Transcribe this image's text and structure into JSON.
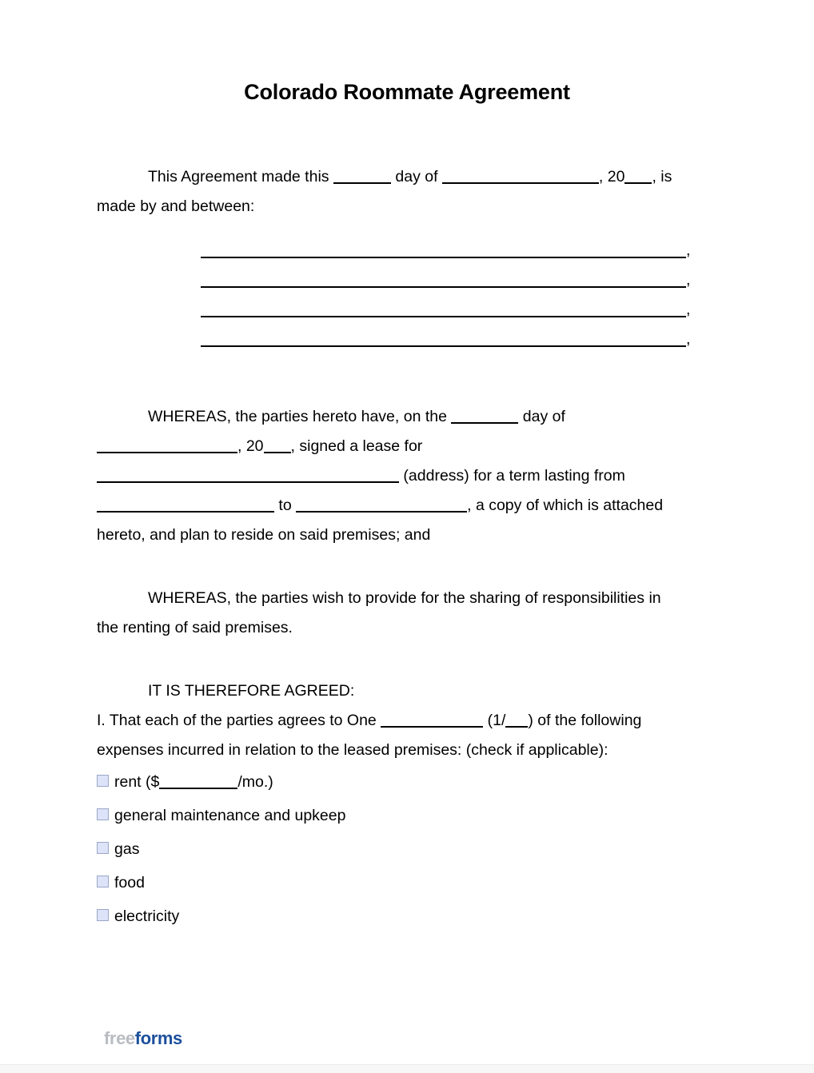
{
  "document": {
    "title": "Colorado Roommate Agreement",
    "intro": {
      "lead": "This Agreement made this",
      "day_of": "day of",
      "year_prefix": ", 20",
      "tail": ", is",
      "made_by": "made by and between:",
      "line_comma": ","
    },
    "whereas_1": {
      "p1_a": "WHEREAS, the parties hereto have, on the",
      "p1_b": "day of",
      "p2_year_prefix": ", 20",
      "p2_b": ", signed a lease for",
      "p3_b": "(address) for a term lasting from",
      "p4_b": "to",
      "p4_c": ", a copy of which is attached",
      "p5": "hereto, and plan to reside on said premises; and"
    },
    "whereas_2": {
      "line1": "WHEREAS, the parties wish to provide for the sharing of responsibilities in",
      "line2": "the renting of said premises."
    },
    "agreed": {
      "heading": "IT IS THEREFORE AGREED:",
      "item_1_a": "I. That each of the parties agrees to One",
      "item_1_b": "(1/",
      "item_1_c": ") of the following",
      "item_1_d": "expenses incurred in relation to the leased premises: (check if applicable):"
    },
    "expenses": [
      {
        "prefix": "rent ($",
        "suffix": "/mo.)",
        "has_field": true,
        "label": ""
      },
      {
        "prefix": "",
        "suffix": "",
        "has_field": false,
        "label": "general maintenance and upkeep"
      },
      {
        "prefix": "",
        "suffix": "",
        "has_field": false,
        "label": "gas"
      },
      {
        "prefix": "",
        "suffix": "",
        "has_field": false,
        "label": "food"
      },
      {
        "prefix": "",
        "suffix": "",
        "has_field": false,
        "label": "electricity"
      }
    ],
    "footer": {
      "logo_part1": "free",
      "logo_part2": "forms"
    },
    "colors": {
      "field_fill": "#d4dcf8",
      "checkbox_fill": "#dde3f9",
      "checkbox_border": "#9aa7c7",
      "logo_gray": "#b9bcc1",
      "logo_blue": "#1c4f9c",
      "text": "#000000",
      "page_background": "#ffffff"
    }
  }
}
